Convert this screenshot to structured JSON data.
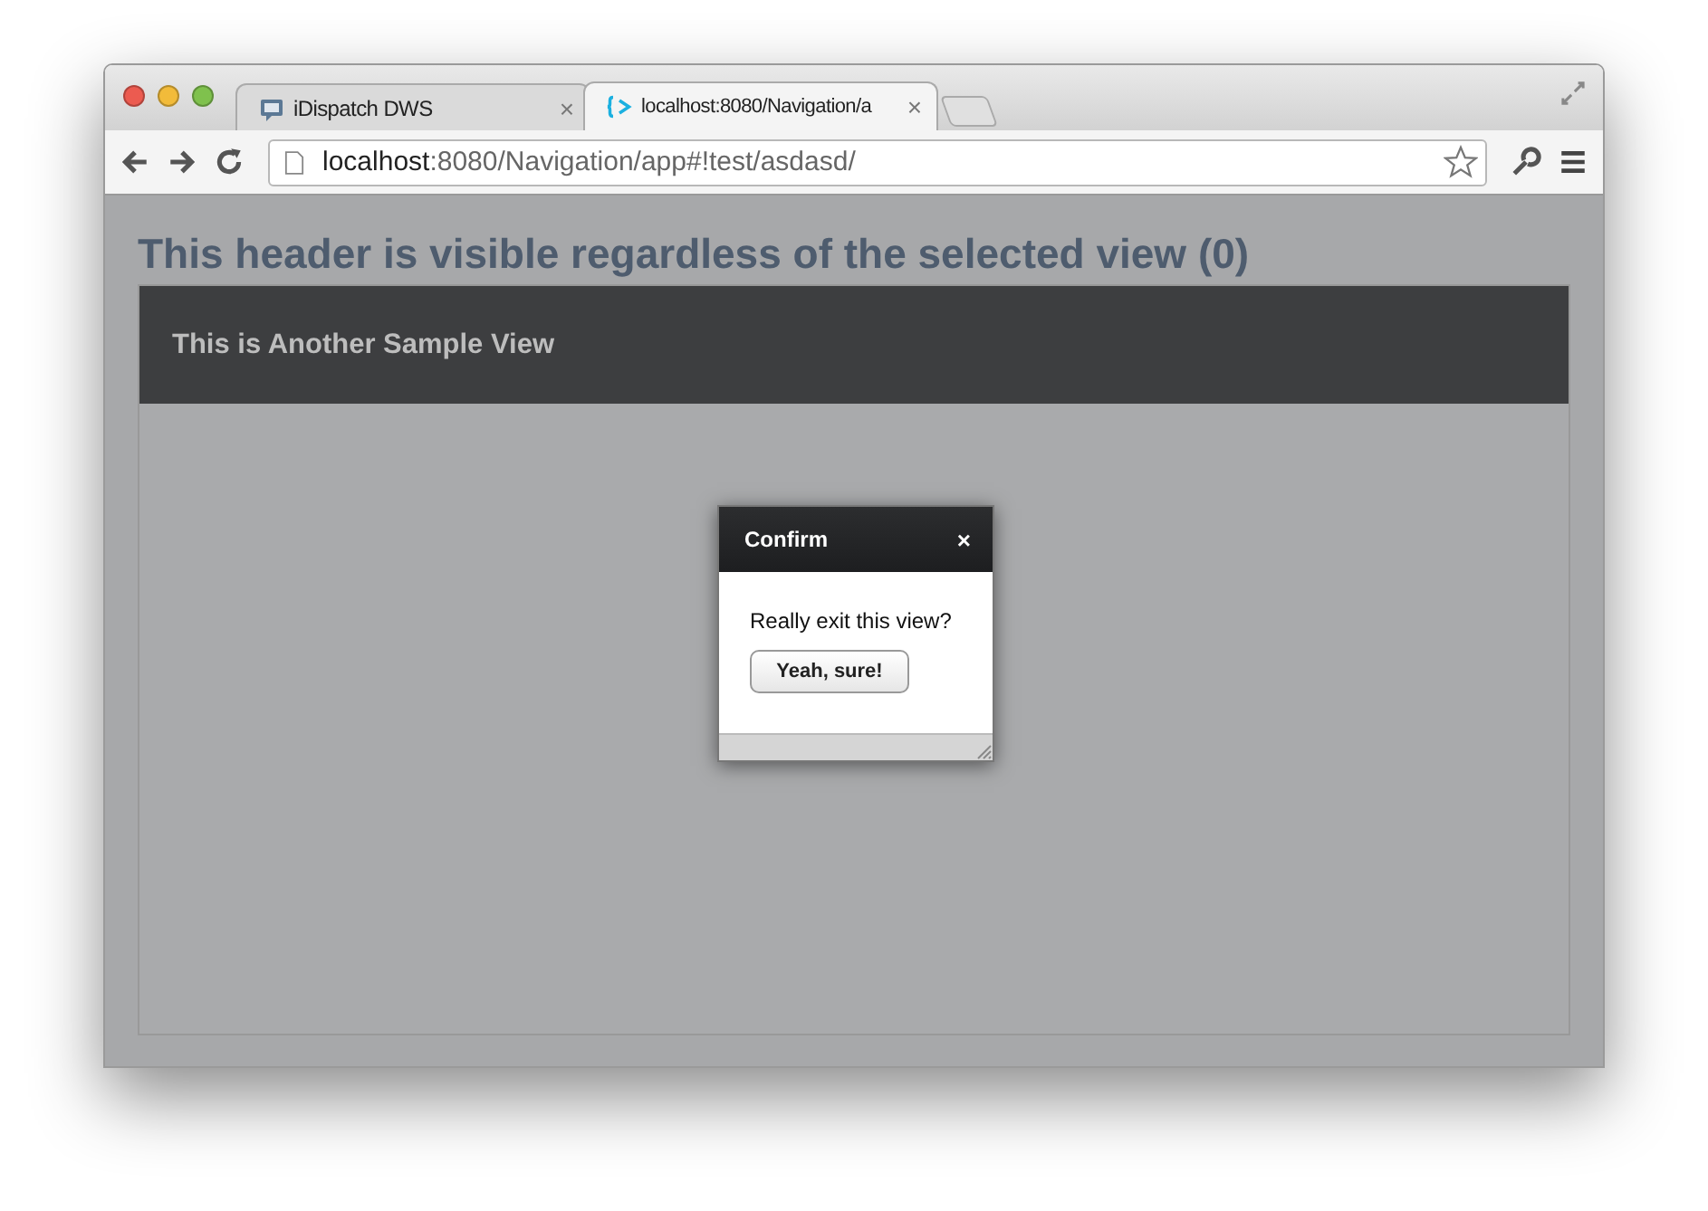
{
  "tabs": [
    {
      "title": "iDispatch DWS",
      "kind": "app",
      "close": "×",
      "selected": false
    },
    {
      "title": "localhost:8080/Navigation/a",
      "kind": "brackets",
      "close": "×",
      "selected": true
    }
  ],
  "address": {
    "host": "localhost",
    "path": ":8080/Navigation/app#!test/asdasd/"
  },
  "page": {
    "heading": "This header is visible regardless of the selected view (0)",
    "view_title": "This is Another Sample View"
  },
  "dialog": {
    "title": "Confirm",
    "close": "×",
    "message": "Really exit this view?",
    "button": "Yeah, sure!"
  }
}
